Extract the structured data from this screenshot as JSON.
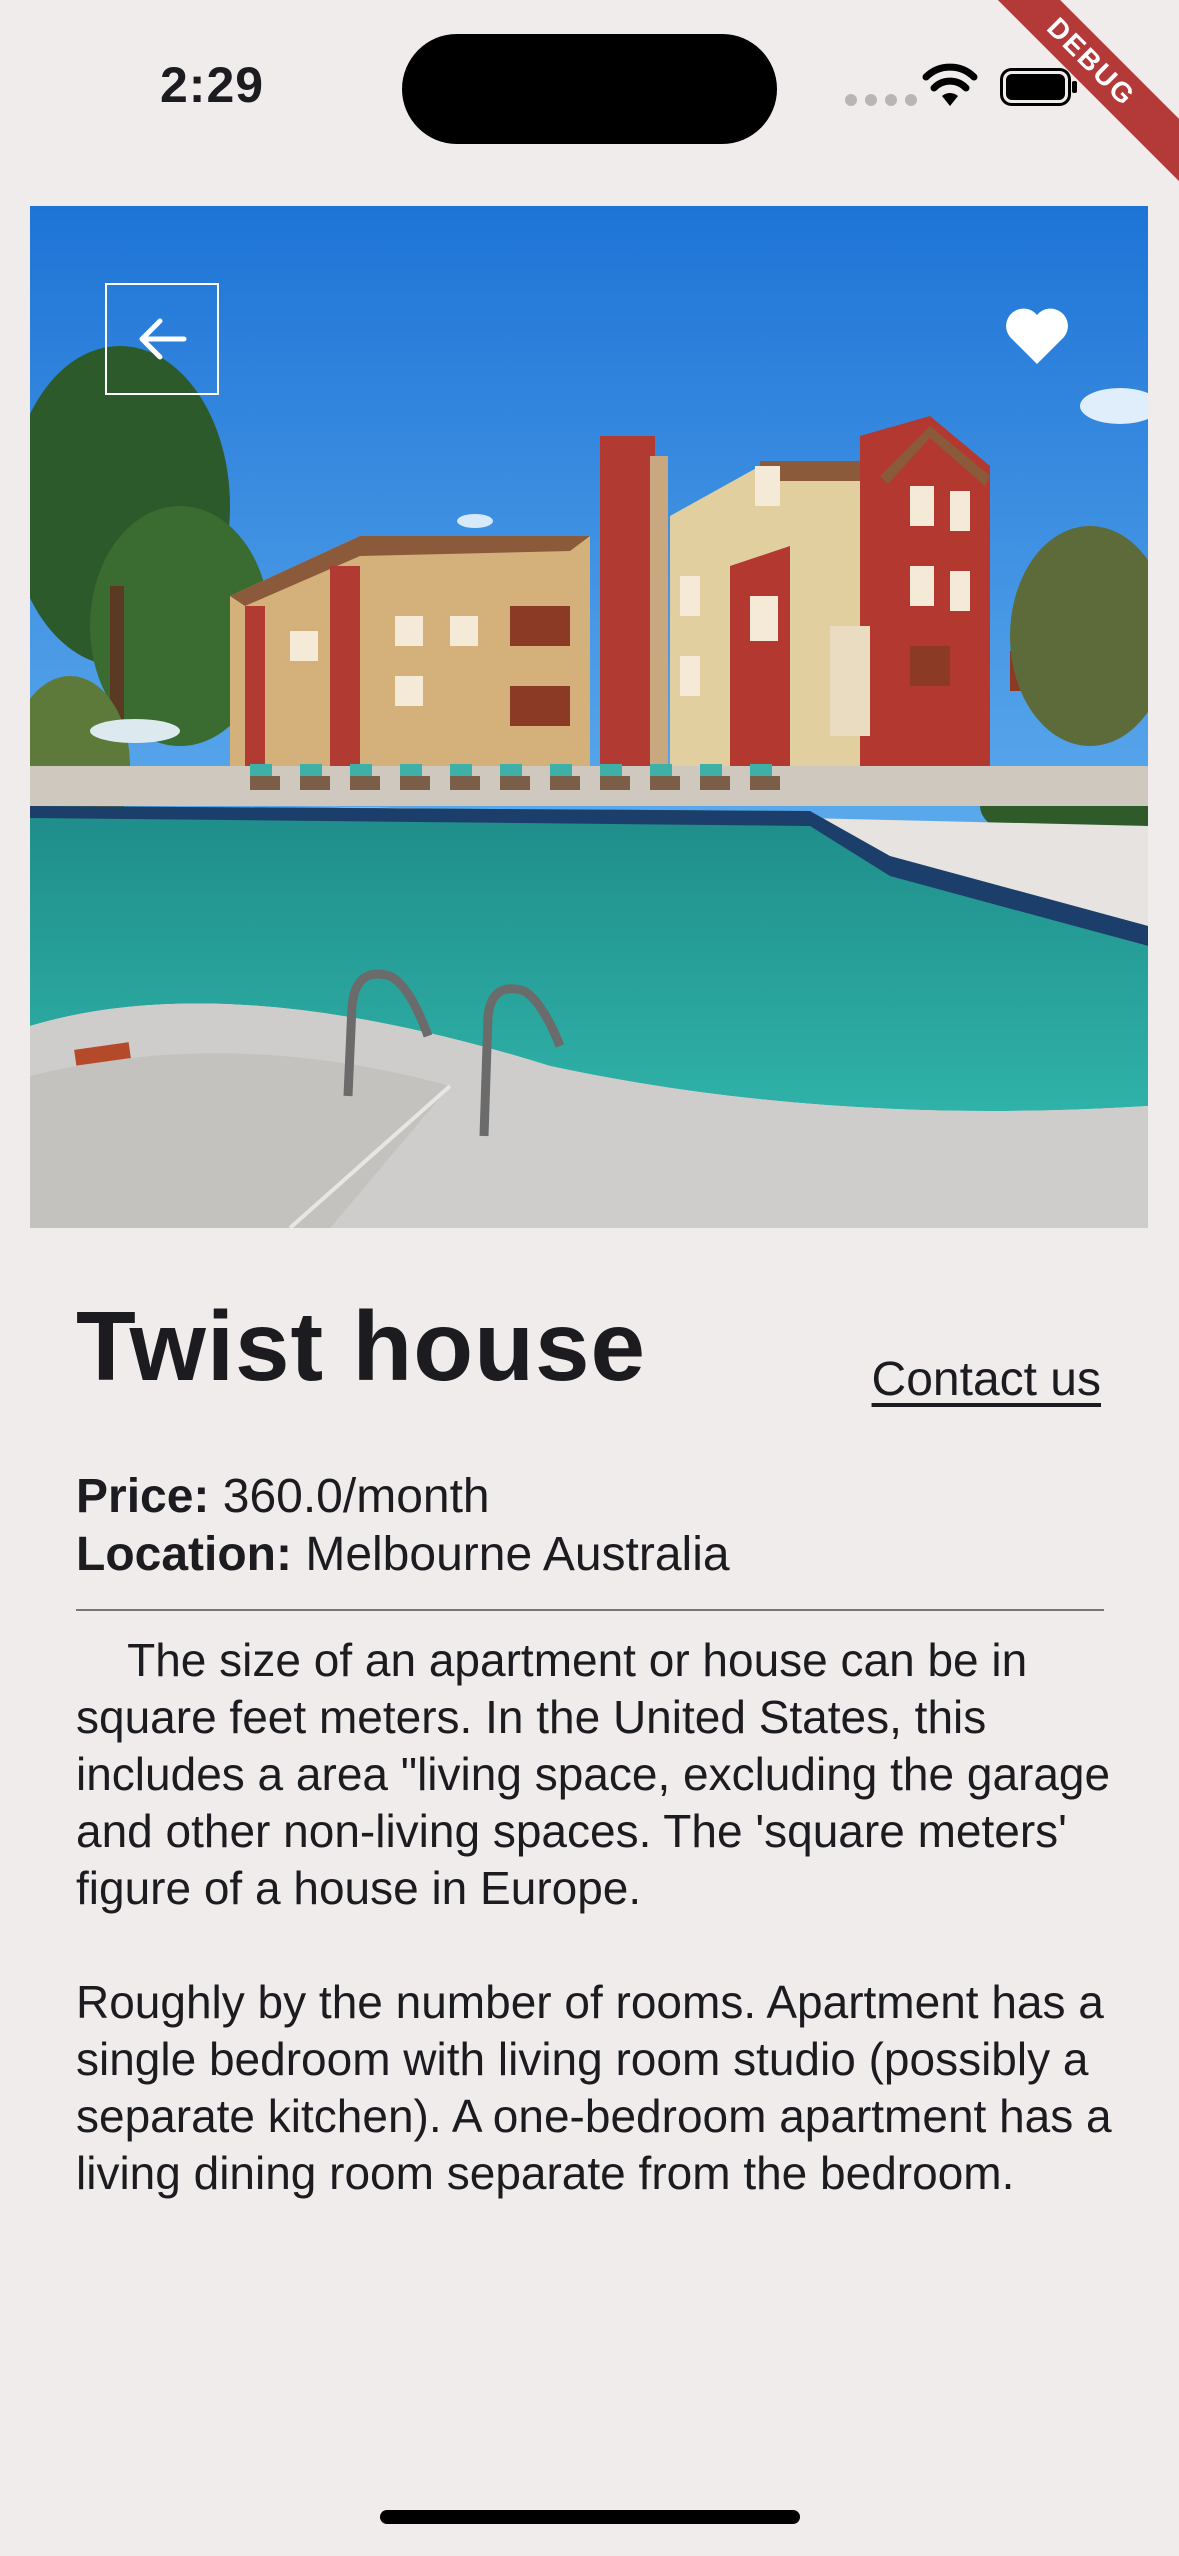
{
  "status_bar": {
    "time": "2:29"
  },
  "debug_banner": "DEBUG",
  "hero": {
    "image_desc": "apartment-complex-pool-photo"
  },
  "property": {
    "title": "Twist house",
    "contact_label": "Contact us",
    "price_label": "Price:",
    "price_value": "360.0/month",
    "location_label": "Location:",
    "location_value": "Melbourne Australia",
    "description": "    The size of an apartment or house can be in square feet meters. In the United States, this includes a area \"living space, excluding the garage and other non-living spaces. The 'square meters' figure of a house in Europe.\n\nRoughly by the number of rooms. Apartment has a single bedroom with living room studio (possibly a separate kitchen). A one-bedroom apartment has a living dining room separate from the bedroom."
  },
  "icons": {
    "back": "arrow-left-icon",
    "favorite": "heart-icon"
  },
  "colors": {
    "background": "#F0ECEC",
    "text": "#1C1B1F",
    "ribbon": "#B43A3A"
  }
}
